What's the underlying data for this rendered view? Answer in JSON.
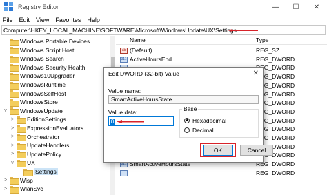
{
  "window": {
    "title": "Registry Editor",
    "minimize": "—",
    "maximize": "☐",
    "close": "✕"
  },
  "menu": [
    "File",
    "Edit",
    "View",
    "Favorites",
    "Help"
  ],
  "address": "Computer\\HKEY_LOCAL_MACHINE\\SOFTWARE\\Microsoft\\WindowsUpdate\\UX\\Settings",
  "tree": [
    {
      "label": "Windows Portable Devices",
      "expander": ""
    },
    {
      "label": "Windows Script Host",
      "expander": ""
    },
    {
      "label": "Windows Search",
      "expander": ""
    },
    {
      "label": "Windows Security Health",
      "expander": ""
    },
    {
      "label": "Windows10Upgrader",
      "expander": ""
    },
    {
      "label": "WindowsRuntime",
      "expander": ""
    },
    {
      "label": "WindowsSelfHost",
      "expander": ""
    },
    {
      "label": "WindowsStore",
      "expander": ""
    },
    {
      "label": "WindowsUpdate",
      "expander": "v"
    },
    {
      "label": "EditionSettings",
      "expander": ">"
    },
    {
      "label": "ExpressionEvaluators",
      "expander": ">"
    },
    {
      "label": "Orchestrator",
      "expander": ">"
    },
    {
      "label": "UpdateHandlers",
      "expander": ">"
    },
    {
      "label": "UpdatePolicy",
      "expander": ">"
    },
    {
      "label": "UX",
      "expander": "v"
    },
    {
      "label": "Settings",
      "expander": ""
    },
    {
      "label": "Wisp",
      "expander": ">"
    },
    {
      "label": "WlanSvc",
      "expander": ">"
    }
  ],
  "values_header": {
    "name": "Name",
    "type": "Type"
  },
  "values": [
    {
      "name": "(Default)",
      "type": "REG_SZ",
      "icon": "ab"
    },
    {
      "name": "ActiveHoursEnd",
      "type": "REG_DWORD",
      "icon": "011"
    },
    {
      "name": "",
      "type": "REG_DWORD",
      "icon": ""
    },
    {
      "name": "",
      "type": "REG_DWORD",
      "icon": ""
    },
    {
      "name": "",
      "type": "REG_DWORD",
      "icon": ""
    },
    {
      "name": "",
      "type": "REG_DWORD",
      "icon": ""
    },
    {
      "name": "",
      "type": "REG_DWORD",
      "icon": ""
    },
    {
      "name": "",
      "type": "REG_DWORD",
      "icon": ""
    },
    {
      "name": "",
      "type": "REG_DWORD",
      "icon": ""
    },
    {
      "name": "",
      "type": "REG_DWORD",
      "icon": ""
    },
    {
      "name": "",
      "type": "REG_DWORD",
      "icon": ""
    },
    {
      "name": "",
      "type": "REG_DWORD",
      "icon": ""
    },
    {
      "name": "",
      "type": "REG_DWORD",
      "icon": ""
    },
    {
      "name": "SmartActiveHoursState",
      "type": "REG_DWORD",
      "icon": "011"
    },
    {
      "name": "",
      "type": "REG_DWORD",
      "icon": ""
    }
  ],
  "dialog": {
    "title": "Edit DWORD (32-bit) Value",
    "close": "✕",
    "value_name_label": "Value name:",
    "value_name": "SmartActiveHoursState",
    "value_data_label": "Value data:",
    "value_data": "0",
    "base_label": "Base",
    "hex_label": "Hexadecimal",
    "dec_label": "Decimal",
    "ok_label": "OK",
    "cancel_label": "Cancel"
  },
  "colors": {
    "accent": "#0078d7",
    "annotation": "#d8232a",
    "folder": "#f3cd5c"
  }
}
